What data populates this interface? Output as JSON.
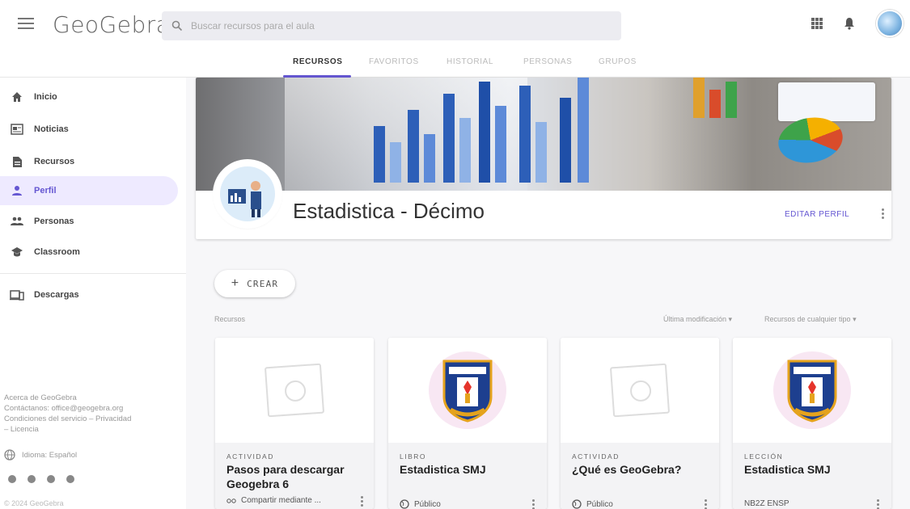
{
  "app": {
    "logo_text": "GeoGebra"
  },
  "search": {
    "placeholder": "Buscar recursos para el aula"
  },
  "tabs": [
    {
      "label": "RECURSOS",
      "active": true
    },
    {
      "label": "FAVORITOS",
      "active": false
    },
    {
      "label": "HISTORIAL",
      "active": false
    },
    {
      "label": "PERSONAS",
      "active": false
    },
    {
      "label": "GRUPOS",
      "active": false
    }
  ],
  "sidebar": {
    "items": [
      {
        "label": "Inicio",
        "icon": "home-icon"
      },
      {
        "label": "Noticias",
        "icon": "news-icon"
      },
      {
        "label": "Recursos",
        "icon": "resources-icon"
      },
      {
        "label": "Perfil",
        "icon": "person-icon",
        "active": true
      },
      {
        "label": "Personas",
        "icon": "people-icon"
      },
      {
        "label": "Classroom",
        "icon": "school-icon"
      },
      {
        "label": "Descargas",
        "icon": "download-icon"
      }
    ],
    "footer_links": "Acerca de GeoGebra\nContáctanos: office@geogebra.org\nCondiciones del servicio – Privacidad\n– Licencia",
    "language": "Idioma: Español",
    "copyright": "© 2024 GeoGebra"
  },
  "profile": {
    "name": "Estadistica - Décimo",
    "edit_label": "EDITAR PERFIL"
  },
  "main": {
    "create_label": "CREAR",
    "resources_label": "Recursos",
    "sort_modified": "Última modificación",
    "sort_type": "Recursos de cualquier tipo"
  },
  "cards": [
    {
      "type": "ACTIVIDAD",
      "title": "Pasos para descargar Geogebra 6",
      "footer": "Compartir mediante ...",
      "thumb": "placeholder"
    },
    {
      "type": "LIBRO",
      "title": "Estadistica SMJ",
      "footer": "Público",
      "thumb": "seal"
    },
    {
      "type": "ACTIVIDAD",
      "title": "¿Qué es GeoGebra?",
      "footer": "Público",
      "thumb": "placeholder"
    },
    {
      "type": "LECCIÓN",
      "title": "Estadistica SMJ",
      "footer": "NB2Z ENSP",
      "thumb": "seal"
    }
  ],
  "colors": {
    "accent": "#6557d2",
    "active_bg": "#eeeaff"
  }
}
